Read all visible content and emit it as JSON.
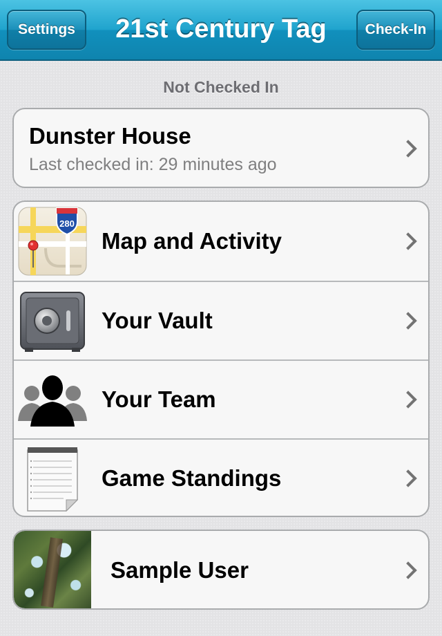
{
  "navbar": {
    "title": "21st Century Tag",
    "left_button": "Settings",
    "right_button": "Check-In"
  },
  "section_header": "Not Checked In",
  "status": {
    "location": "Dunster House",
    "last_checked": "Last checked in: 29 minutes ago"
  },
  "menu": {
    "items": [
      {
        "label": "Map and Activity",
        "icon": "map-icon"
      },
      {
        "label": "Your Vault",
        "icon": "vault-icon"
      },
      {
        "label": "Your Team",
        "icon": "team-icon"
      },
      {
        "label": "Game Standings",
        "icon": "notepad-icon"
      }
    ],
    "map_sign_number": "280"
  },
  "user": {
    "name": "Sample User",
    "icon": "user-photo"
  },
  "colors": {
    "navbar": "#1fa3cd",
    "background": "#e3e3e5",
    "cell": "#f7f7f7",
    "section_text": "#6d6d72",
    "subtitle_text": "#7f7f80"
  }
}
